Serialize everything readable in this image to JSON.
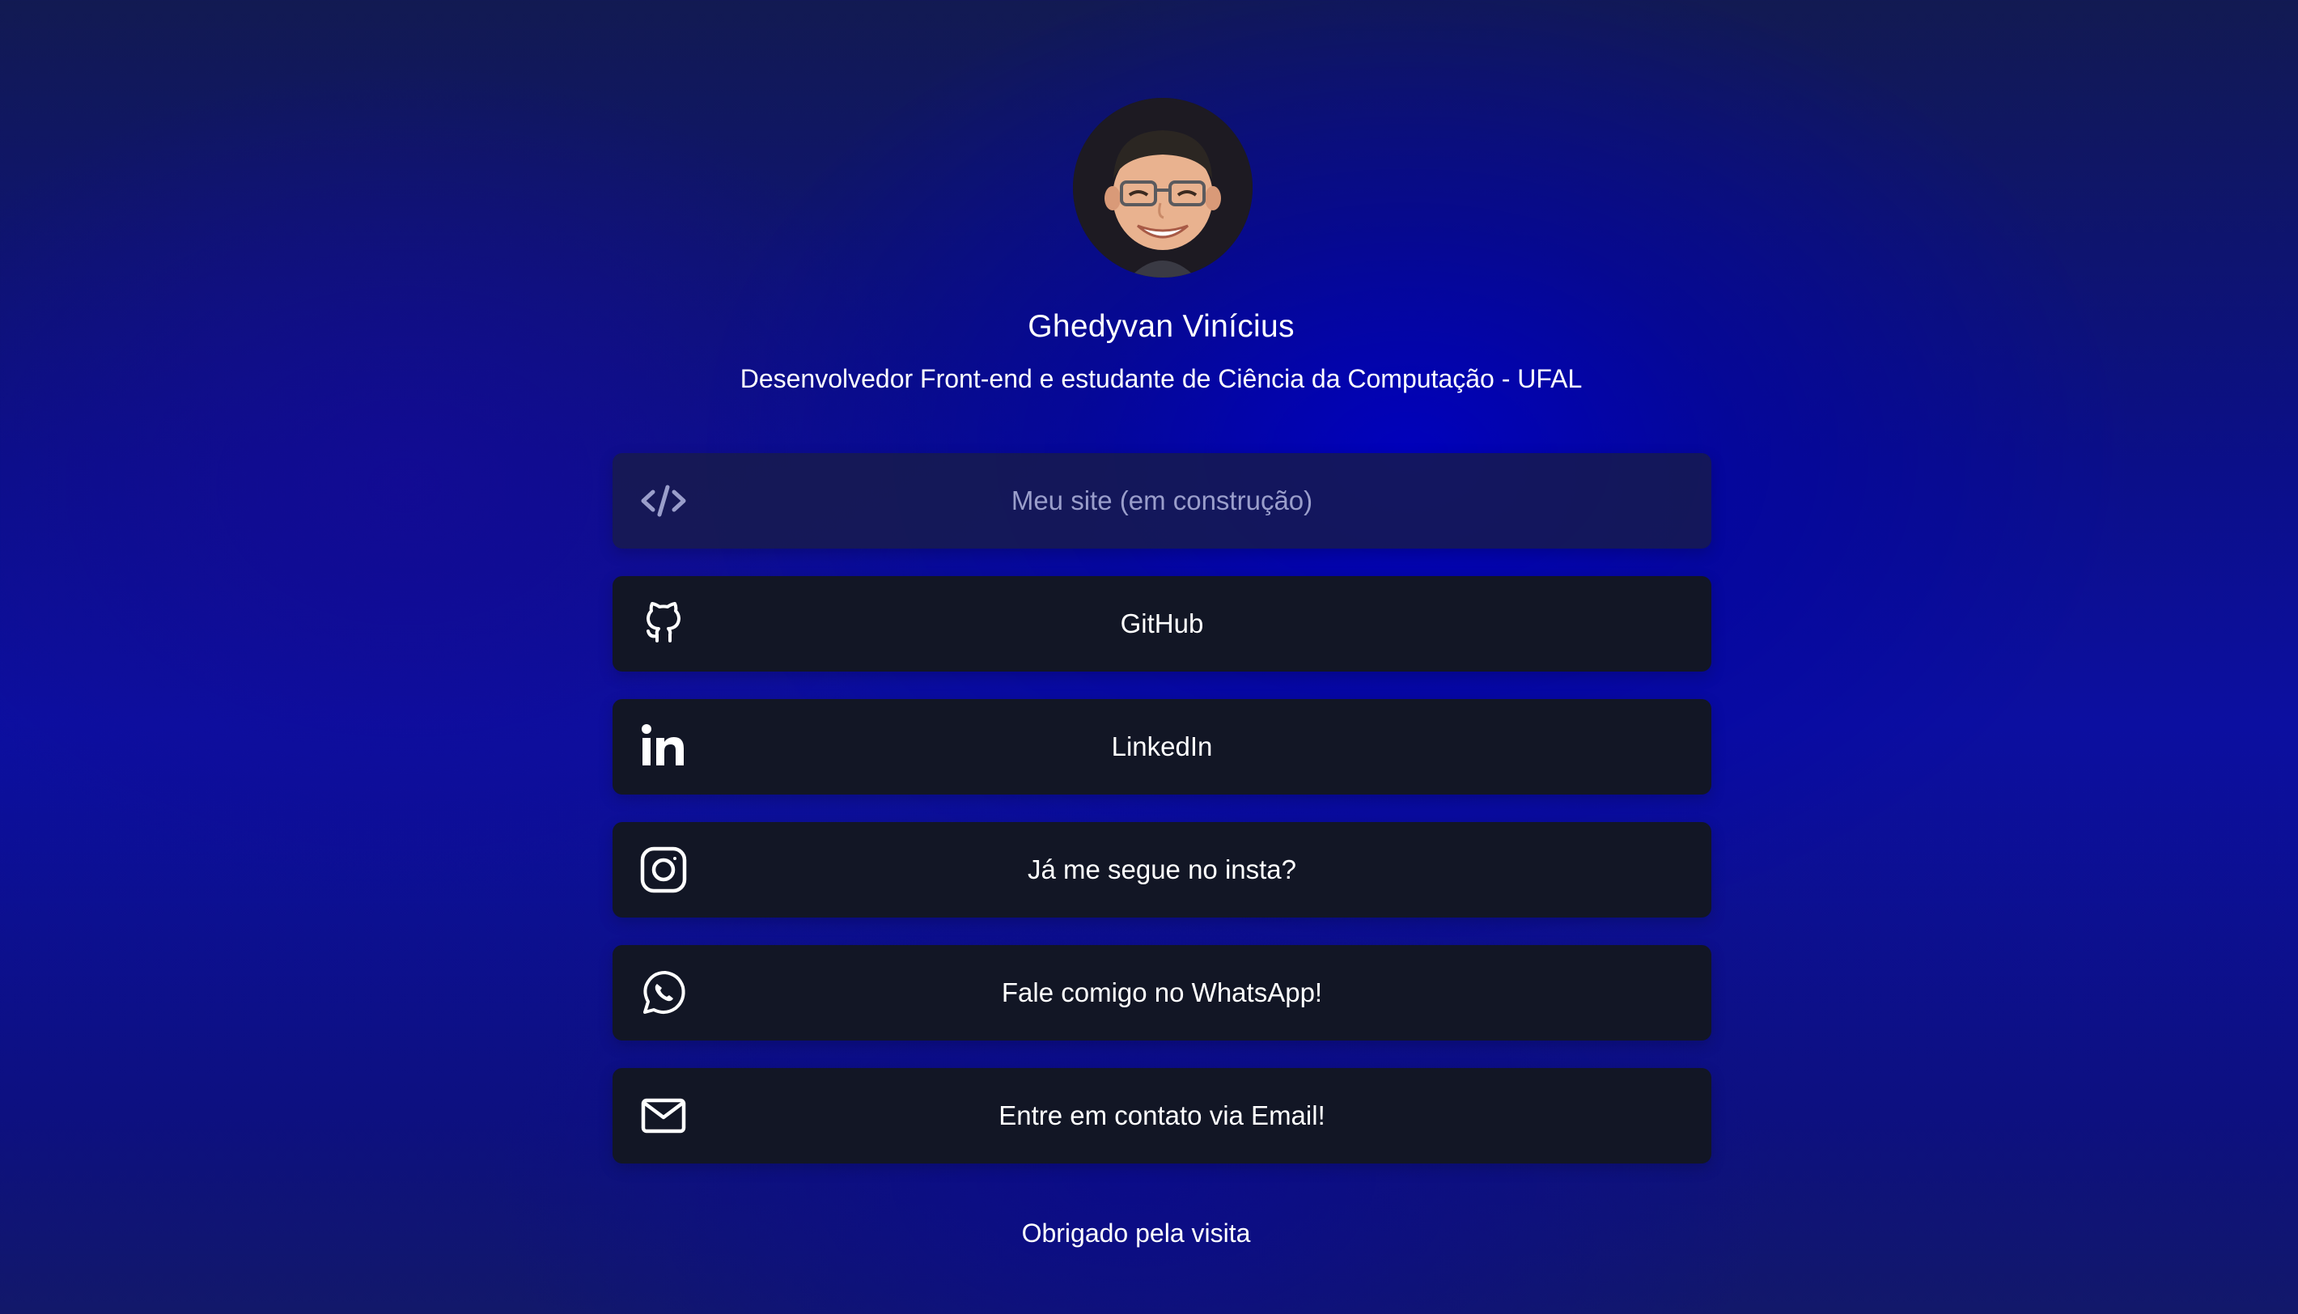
{
  "profile": {
    "name": "Ghedyvan Vinícius",
    "bio": "Desenvolvedor Front-end e estudante de Ciência da Computação - UFAL"
  },
  "links": [
    {
      "label": "Meu site (em construção)",
      "icon": "code-icon",
      "disabled": true
    },
    {
      "label": "GitHub",
      "icon": "github-icon"
    },
    {
      "label": "LinkedIn",
      "icon": "linkedin-icon"
    },
    {
      "label": "Já me segue no insta?",
      "icon": "instagram-icon"
    },
    {
      "label": "Fale comigo no WhatsApp!",
      "icon": "whatsapp-icon"
    },
    {
      "label": "Entre em contato via Email!",
      "icon": "mail-icon"
    }
  ],
  "footer": {
    "text": "Obrigado pela visita"
  },
  "colors": {
    "button_bg": "#121625",
    "disabled_text": "#9a9ecb",
    "accent_blue": "#0c0fa0"
  }
}
